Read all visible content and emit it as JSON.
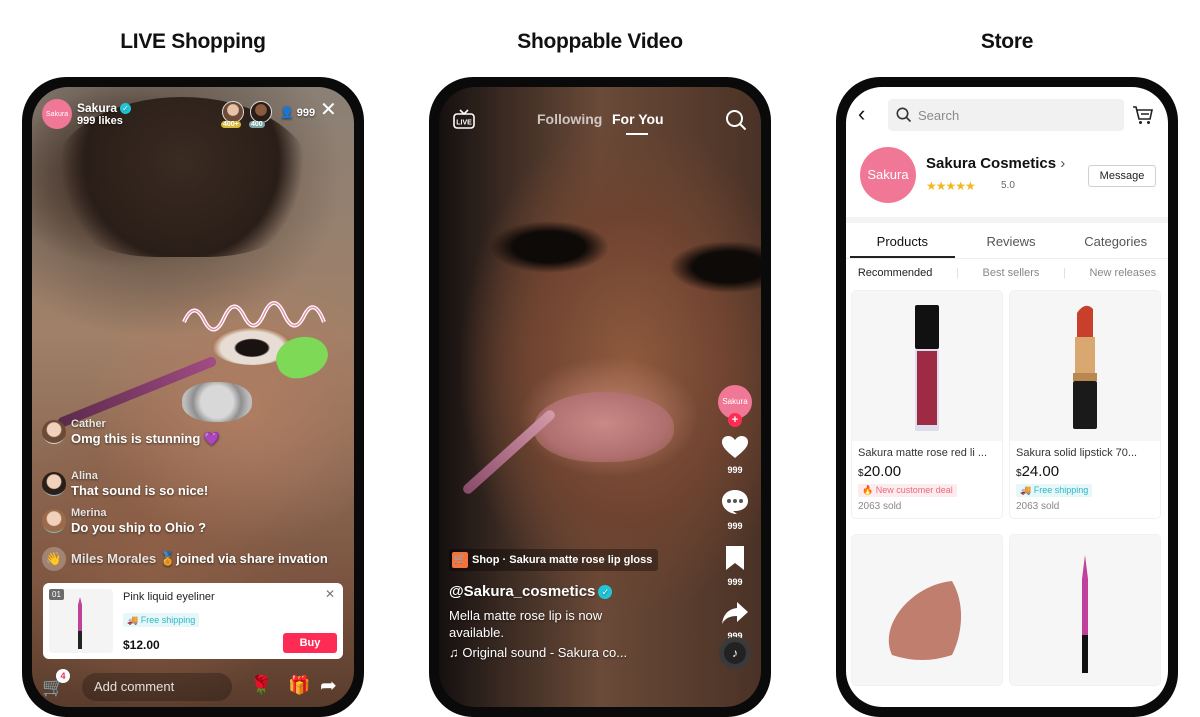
{
  "sections": {
    "live": "LIVE Shopping",
    "video": "Shoppable Video",
    "store": "Store"
  },
  "live": {
    "host": {
      "avatar_label": "Sakura",
      "name": "Sakura",
      "likes": "999 likes",
      "verified": true
    },
    "viewers": [
      {
        "badge": "400+"
      },
      {
        "badge": "400"
      }
    ],
    "viewer_count": "999",
    "close_icon": "close-icon",
    "comments": [
      {
        "user": "Cather",
        "text": "Omg this is stunning 💜"
      },
      {
        "user": "Alina",
        "text": "That sound is so nice!"
      },
      {
        "user": "Merina",
        "text": "Do you ship to Ohio ?"
      }
    ],
    "join_notice": {
      "user": "Miles Morales",
      "badge": "🏅",
      "text": "joined via share invation"
    },
    "product_card": {
      "index": "01",
      "title": "Pink liquid eyeliner",
      "tag": "Free shipping",
      "price": "$12.00",
      "buy_label": "Buy"
    },
    "bottom_bar": {
      "cart_count": "4",
      "comment_placeholder": "Add comment"
    }
  },
  "video": {
    "live_icon_label": "LIVE",
    "tabs": [
      {
        "label": "Following",
        "active": false
      },
      {
        "label": "For You",
        "active": true
      }
    ],
    "creator_avatar_label": "Sakura",
    "actions": [
      {
        "icon": "heart-icon",
        "count": "999"
      },
      {
        "icon": "comment-icon",
        "count": "999"
      },
      {
        "icon": "bookmark-icon",
        "count": "999"
      },
      {
        "icon": "share-icon",
        "count": "999"
      }
    ],
    "shop_tag": "Shop · Sakura matte rose lip gloss",
    "handle": "@Sakura_cosmetics",
    "caption": "Mella matte rose lip is now available.",
    "sound": "Original sound - Sakura co..."
  },
  "store": {
    "search_placeholder": "Search",
    "store_avatar_label": "Sakura",
    "store_name": "Sakura Cosmetics",
    "stars": "★★★★★",
    "rating": "5.0",
    "message_label": "Message",
    "tabs": [
      {
        "label": "Products",
        "active": true
      },
      {
        "label": "Reviews",
        "active": false
      },
      {
        "label": "Categories",
        "active": false
      }
    ],
    "subtabs": [
      {
        "label": "Recommended",
        "active": true
      },
      {
        "label": "Best sellers",
        "active": false
      },
      {
        "label": "New releases",
        "active": false
      }
    ],
    "products": [
      {
        "title": "Sakura matte rose red li ...",
        "currency": "$",
        "price": "20.00",
        "tag": "New customer deal",
        "tag_type": "deal",
        "sold": "2063 sold"
      },
      {
        "title": "Sakura solid lipstick 70...",
        "currency": "$",
        "price": "24.00",
        "tag": "Free shipping",
        "tag_type": "shipping",
        "sold": "2063 sold"
      },
      {
        "title": "",
        "currency": "",
        "price": "",
        "tag": "",
        "sold": ""
      },
      {
        "title": "",
        "currency": "",
        "price": "",
        "tag": "",
        "sold": ""
      }
    ]
  }
}
